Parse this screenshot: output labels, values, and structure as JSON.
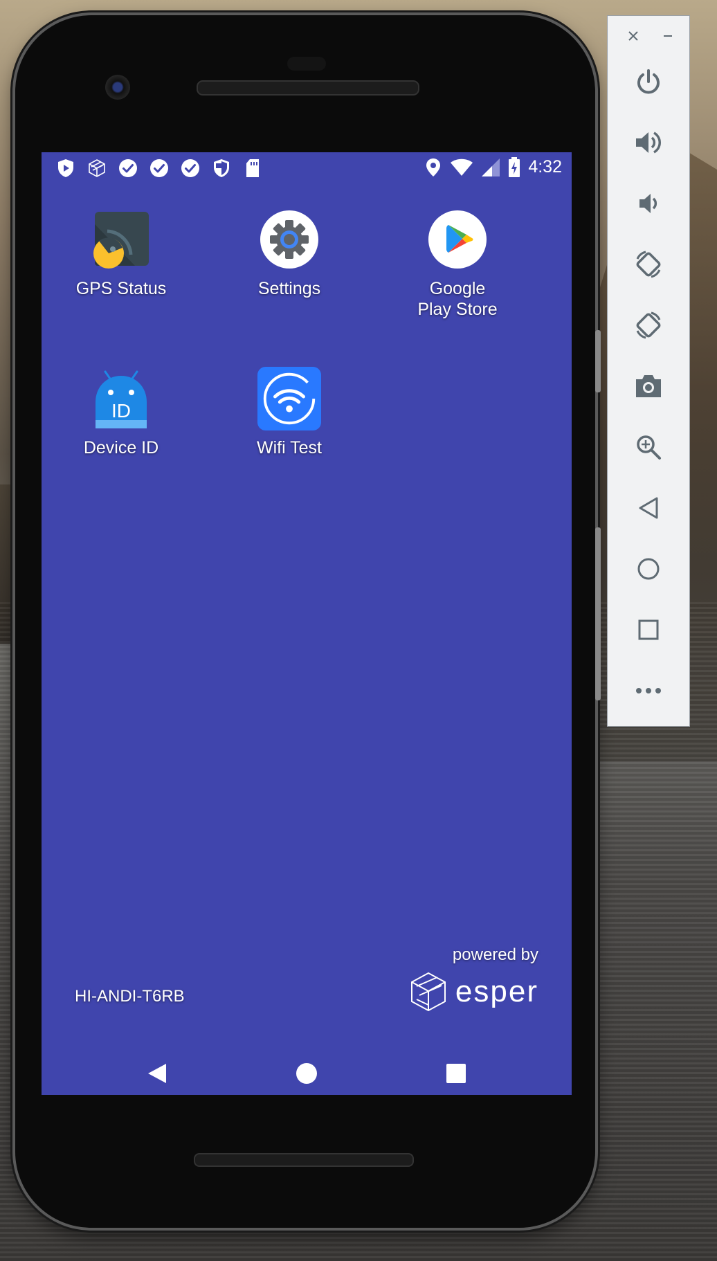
{
  "status_bar": {
    "time": "4:32",
    "left_icons": [
      "esper-shield-icon",
      "cube-logo-icon",
      "check-circle-icon",
      "check-circle-icon",
      "check-circle-icon",
      "shield-icon",
      "sd-card-icon"
    ],
    "right_icons": [
      "location-icon",
      "wifi-icon",
      "signal-icon",
      "battery-charging-icon"
    ]
  },
  "apps": [
    {
      "label": "GPS Status",
      "icon": "gps-status-icon"
    },
    {
      "label": "Settings",
      "icon": "settings-gear-icon"
    },
    {
      "label": "Google\nPlay Store",
      "icon": "play-store-icon"
    },
    {
      "label": "Device ID",
      "icon": "android-id-icon"
    },
    {
      "label": "Wifi Test",
      "icon": "wifi-test-icon"
    }
  ],
  "footer": {
    "device_name": "HI-ANDI-T6RB",
    "powered_by": "powered by",
    "brand": "esper"
  },
  "nav": [
    "back-icon",
    "home-icon",
    "recents-icon"
  ],
  "toolbar": {
    "buttons": [
      "power-icon",
      "volume-up-icon",
      "volume-down-icon",
      "rotate-left-icon",
      "rotate-right-icon",
      "camera-icon",
      "zoom-icon",
      "back-icon",
      "home-icon",
      "overview-icon",
      "more-icon"
    ]
  },
  "colors": {
    "screen_bg": "#4045ad",
    "toolbar_bg": "#f1f2f3",
    "toolbar_icon": "#5f6b73"
  }
}
